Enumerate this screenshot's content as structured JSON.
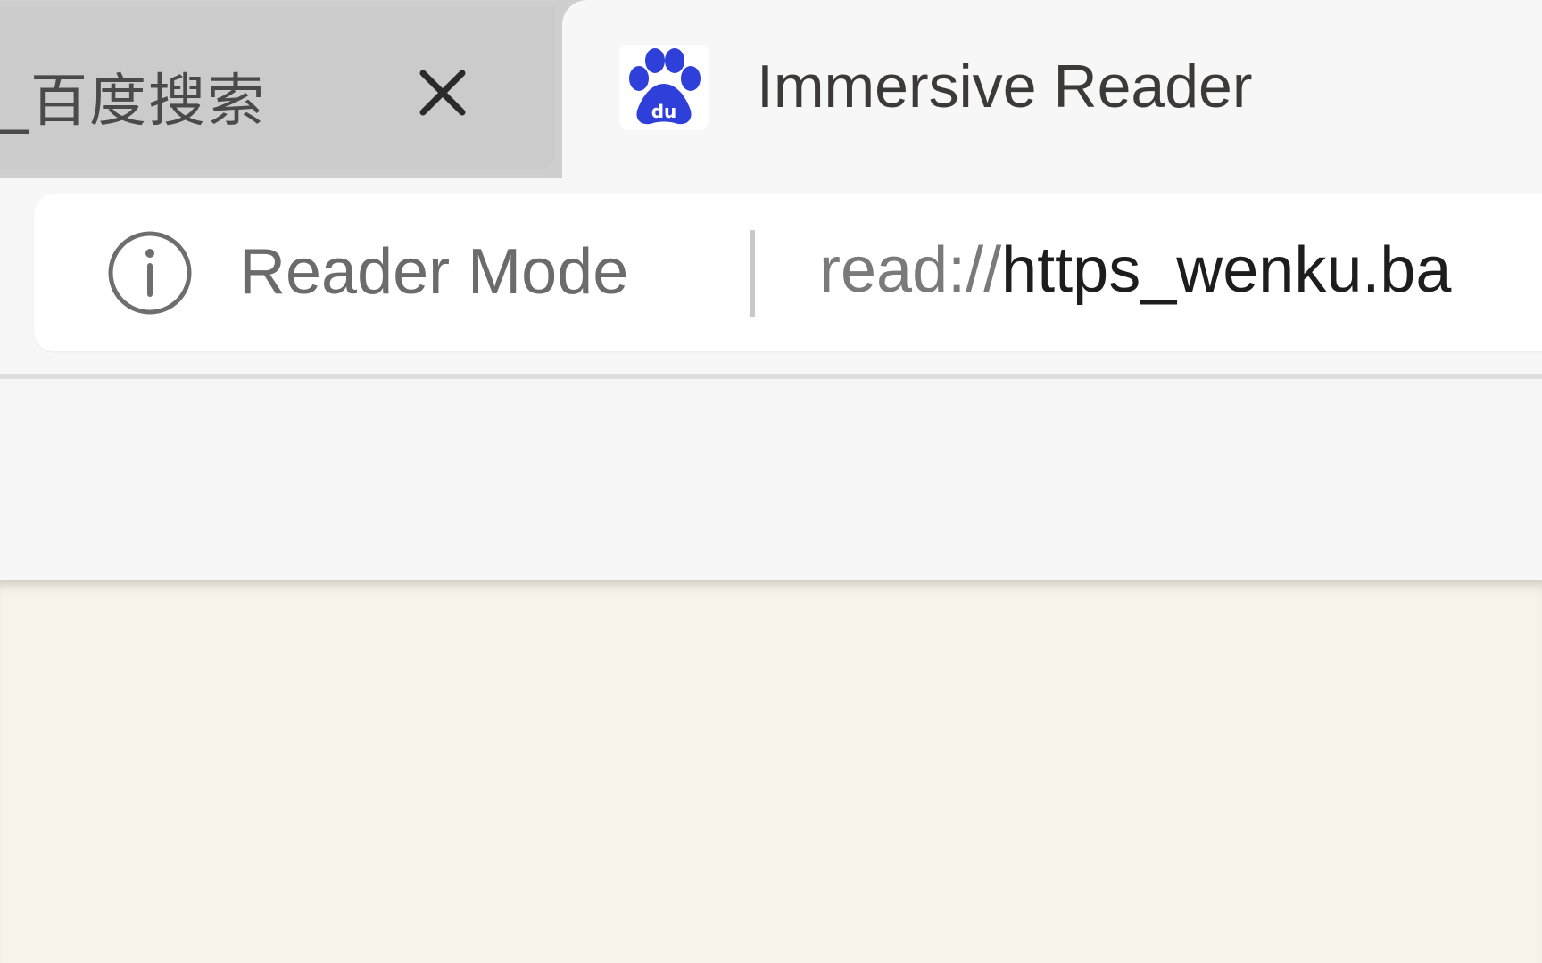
{
  "tabs": [
    {
      "title": "_百度搜索",
      "active": false,
      "close_icon": "close-icon"
    },
    {
      "title": "Immersive Reader",
      "active": true,
      "favicon": "baidu-paw-icon"
    }
  ],
  "omnibox": {
    "info_icon": "info-icon",
    "mode_label": "Reader Mode",
    "url_scheme": "read://",
    "url_rest": "https_wenku.ba"
  },
  "colors": {
    "favicon_blue": "#2f3fd9",
    "page_background": "#f7f3e8",
    "chrome_background": "#f7f7f7"
  }
}
